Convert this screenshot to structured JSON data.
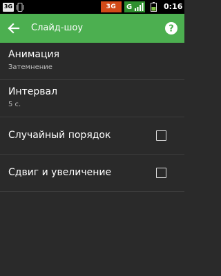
{
  "status_bar": {
    "left_badge": "3G",
    "network_3g": "3G",
    "network_g": "G",
    "clock": "0:16"
  },
  "action_bar": {
    "title": "Слайд-шоу",
    "color": "#4caf50"
  },
  "settings": {
    "animation": {
      "title": "Анимация",
      "value": "Затемнение"
    },
    "interval": {
      "title": "Интервал",
      "value": "5 с."
    },
    "shuffle": {
      "title": "Случайный порядок",
      "checked": false
    },
    "zoom": {
      "title": "Сдвиг и увеличение",
      "checked": false
    }
  },
  "icons": {
    "back": "arrow-left",
    "help": "question-circle",
    "phone": "phone-vibrate",
    "battery": "battery"
  }
}
